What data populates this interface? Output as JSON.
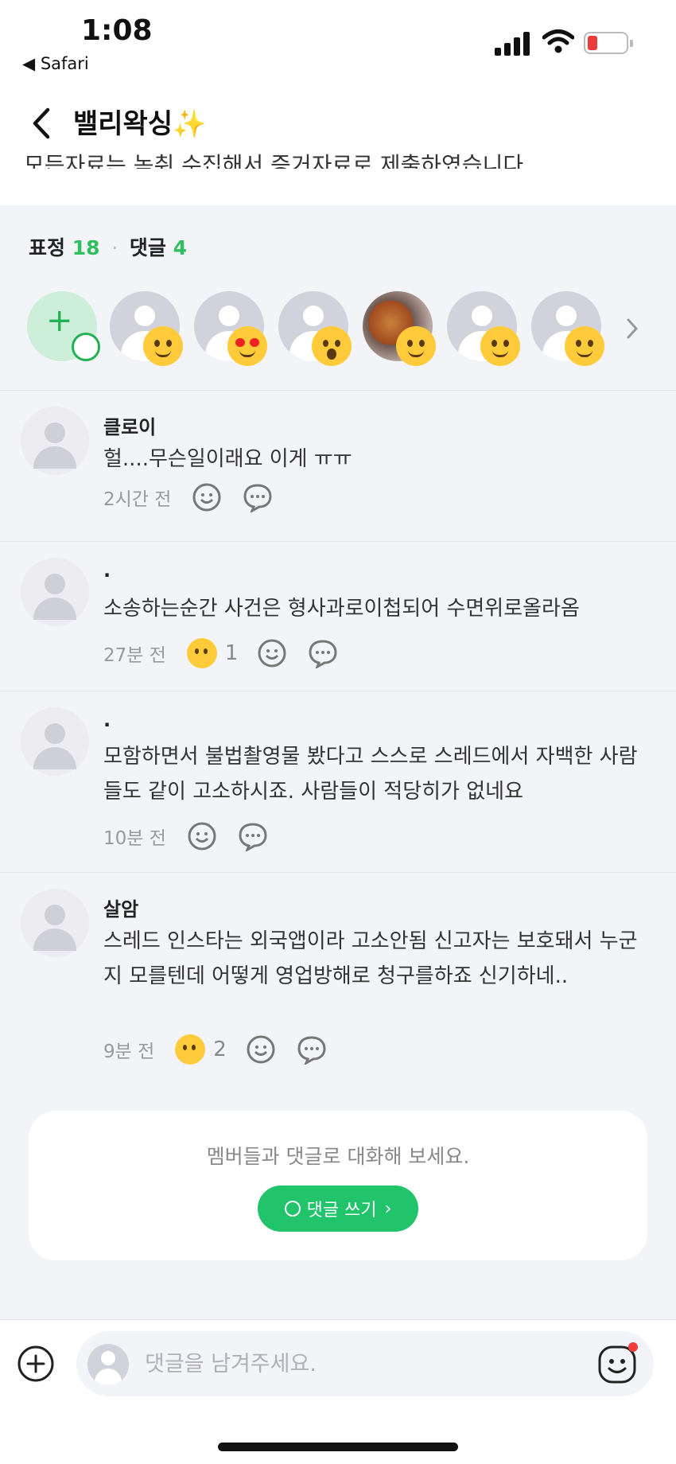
{
  "status": {
    "time": "1:08",
    "back_app": "◀ Safari"
  },
  "header": {
    "title": "밸리왁싱✨"
  },
  "partial_text": "모든자료는 녹취 수집해서 증거자료로 제출하였습니다.",
  "summary": {
    "reactions_label": "표정",
    "reactions_count": "18",
    "comments_label": "댓글",
    "comments_count": "4"
  },
  "reaction_users": [
    {
      "emoji": "grinning-face-icon"
    },
    {
      "emoji": "heart-eyes-icon"
    },
    {
      "emoji": "astonished-face-icon"
    },
    {
      "emoji": "grinning-face-icon"
    },
    {
      "emoji": "grinning-face-icon"
    },
    {
      "emoji": "grinning-face-icon"
    }
  ],
  "comments": [
    {
      "name": "클로이",
      "text": "헐....무슨일이래요 이게 ㅠㅠ",
      "ago": "2시간 전",
      "reaction_count": ""
    },
    {
      "name": ".",
      "text": "소송하는순간 사건은 형사과로이첩되어 수면위로올라옴",
      "ago": "27분 전",
      "reaction_count": "1"
    },
    {
      "name": ".",
      "text": "모함하면서 불법촬영물 봤다고 스스로 스레드에서 자백한 사람들도 같이 고소하시죠.  사람들이 적당히가 없네요",
      "ago": "10분 전",
      "reaction_count": ""
    },
    {
      "name": "살암",
      "text": "스레드 인스타는 외국앱이라 고소안됨 신고자는 보호돼서 누군지 모를텐데 어떻게 영업방해로 청구를하죠 신기하네..",
      "ago": "9분 전",
      "reaction_count": "2"
    }
  ],
  "cta": {
    "text": "멤버들과 댓글로 대화해 보세요.",
    "button": "댓글 쓰기"
  },
  "composer": {
    "placeholder": "댓글을 남겨주세요."
  },
  "colors": {
    "accent": "#21c46a",
    "count_green": "#2fbf5f",
    "background": "#f3f4f7"
  }
}
